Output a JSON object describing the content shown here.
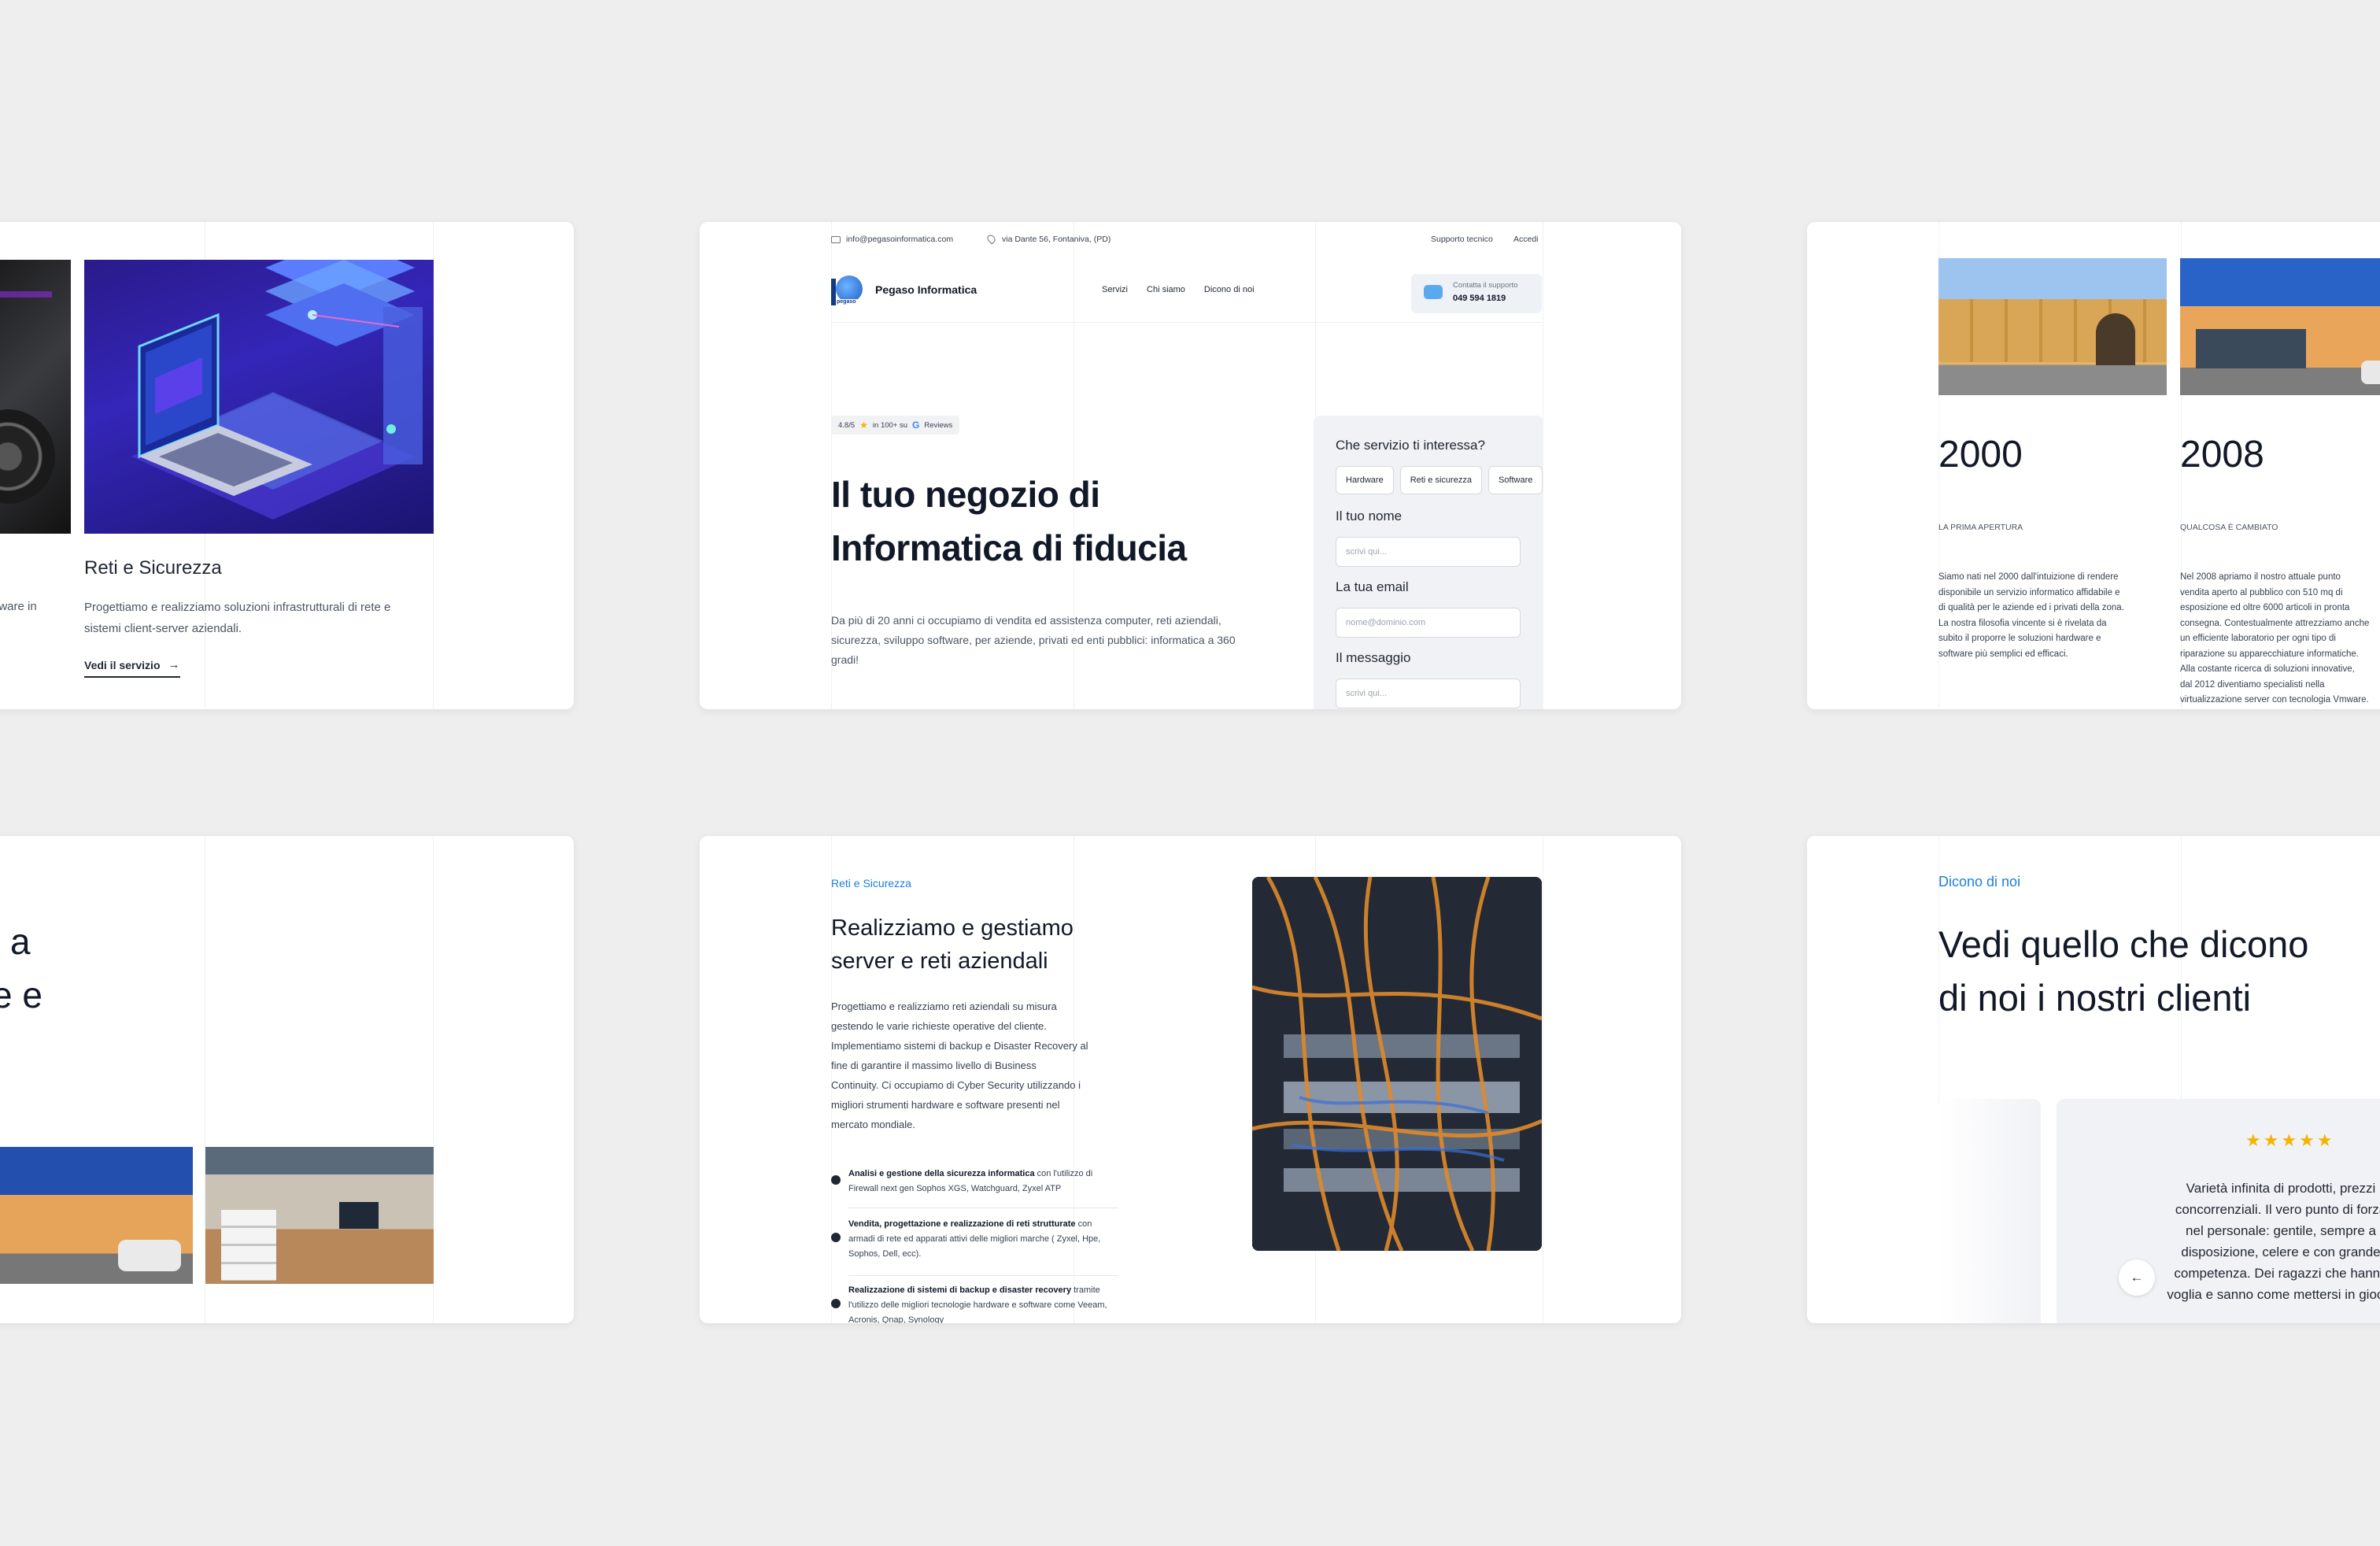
{
  "card_services": {
    "partial_text": "dware in",
    "title": "Reti e Sicurezza",
    "desc": "Progettiamo e realizziamo soluzioni infrastrutturali di rete e sistemi client-server aziendali.",
    "link": "Vedi il servizio"
  },
  "card_hero": {
    "topbar": {
      "email": "info@pegasoinformatica.com",
      "address": "via Dante 56, Fontaniva, (PD)",
      "support": "Supporto tecnico",
      "login": "Accedi"
    },
    "brand": {
      "logo_text": "pegaso",
      "name": "Pegaso Informatica"
    },
    "nav": [
      "Servizi",
      "Chi siamo",
      "Dicono di noi"
    ],
    "contact": {
      "label": "Contatta il supporto",
      "phone": "049 594 1819"
    },
    "rating": {
      "score": "4.8/5",
      "text": "in 100+ su",
      "reviews": "Reviews"
    },
    "title_line1": "Il tuo negozio di",
    "title_line2": "Informatica di fiducia",
    "desc": "Da più di 20 anni ci occupiamo di vendita ed assistenza computer, reti aziendali, sicurezza, sviluppo software, per aziende, privati ed enti pubblici: informatica a 360 gradi!",
    "form": {
      "service_label": "Che servizio ti interessa?",
      "options": [
        "Hardware",
        "Reti e sicurezza",
        "Software"
      ],
      "name_label": "Il tuo nome",
      "name_placeholder": "scrivi qui...",
      "email_label": "La tua email",
      "email_placeholder": "nome@dominio.com",
      "message_label": "Il messaggio",
      "message_placeholder": "scrivi qui..."
    }
  },
  "card_history": {
    "items": [
      {
        "year": "2000",
        "caption": "LA PRIMA APERTURA",
        "lines": [
          "Siamo nati nel 2000 dall'intuizione di rendere",
          "disponibile un servizio informatico affidabile e",
          "di qualità per le aziende ed i privati della zona.",
          "La nostra filosofia vincente si è rivelata da",
          "subito il proporre le soluzioni hardware e",
          "software più semplici ed efficaci."
        ]
      },
      {
        "year": "2008",
        "caption": "QUALCOSA È CAMBIATO",
        "lines": [
          "Nel 2008 apriamo il nostro attuale punto",
          "vendita aperto al pubblico con 510 mq di",
          "esposizione ed oltre 6000 articoli in pronta",
          "consegna. Contestualmente attrezziamo anche",
          "un efficiente laboratorio per ogni tipo di",
          "riparazione su apparecchiature informatiche.",
          "Alla costante ricerca di soluzioni innovative,",
          "dal 2012 diventiamo specialisti nella",
          "virtualizzazione server con tecnologia Vmware."
        ]
      }
    ]
  },
  "card_about": {
    "line1": "i a",
    "line2": "e e"
  },
  "card_network": {
    "eyebrow": "Reti e Sicurezza",
    "title_line1": "Realizziamo e gestiamo",
    "title_line2": "server e reti aziendali",
    "desc_lines": [
      "Progettiamo e realizziamo reti aziendali su misura",
      "gestendo le varie richieste operative del cliente.",
      "Implementiamo sistemi di backup e Disaster Recovery al",
      "fine di garantire il massimo livello di Business",
      "Continuity. Ci occupiamo di Cyber Security utilizzando i",
      "migliori strumenti hardware e software presenti nel",
      "mercato mondiale."
    ],
    "bullets": [
      {
        "bold": "Analisi e gestione della sicurezza informatica",
        "rest": " con l'utilizzo di Firewall next gen Sophos XGS, Watchguard, Zyxel ATP"
      },
      {
        "bold": "Vendita, progettazione e realizzazione di reti strutturate",
        "rest": " con armadi di rete ed apparati attivi delle migliori marche ( Zyxel, Hpe, Sophos, Dell, ecc)."
      },
      {
        "bold": "Realizzazione di sistemi di backup e disaster recovery",
        "rest": " tramite l'utilizzo delle migliori tecnologie hardware e software come Veeam, Acronis, Qnap, Synology"
      }
    ]
  },
  "card_reviews": {
    "eyebrow": "Dicono di noi",
    "title_line1": "Vedi quello che dicono",
    "title_line2": "di noi i nostri clienti",
    "stars": "★★★★★",
    "review_lines": [
      "Varietà infinita di prodotti, prezzi",
      "concorrenziali. Il vero punto di forza",
      "nel personale: gentile, sempre a",
      "disposizione, celere e con grande",
      "competenza. Dei ragazzi che hanno",
      "voglia e sanno come mettersi in gioco."
    ],
    "prev_icon": "arrow-left-icon"
  },
  "colors": {
    "accent": "#1d7fd6",
    "star": "#f5b301",
    "background": "#eeeeee"
  }
}
